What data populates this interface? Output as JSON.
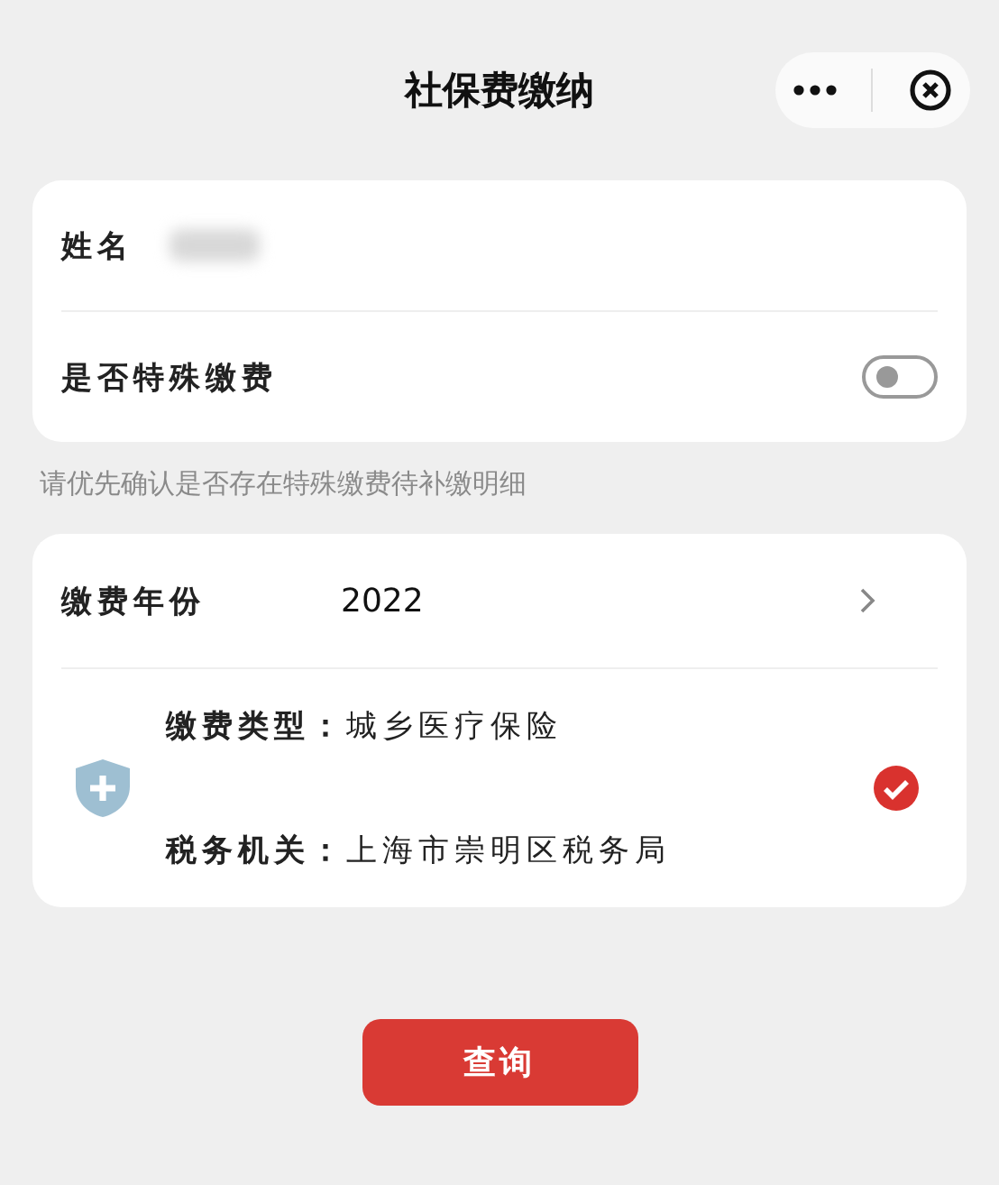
{
  "nav": {
    "title": "社保费缴纳"
  },
  "identity": {
    "name_label": "姓名",
    "special_label": "是否特殊缴费",
    "special_on": false
  },
  "hint": "请优先确认是否存在特殊缴费待补缴明细",
  "year": {
    "label": "缴费年份",
    "value": "2022"
  },
  "insurances": [
    {
      "type_label": "缴费类型：",
      "type_value": "城乡医疗保险",
      "office_label": "税务机关：",
      "office_value": "上海市崇明区税务局",
      "selected": true
    }
  ],
  "submit": "查询"
}
